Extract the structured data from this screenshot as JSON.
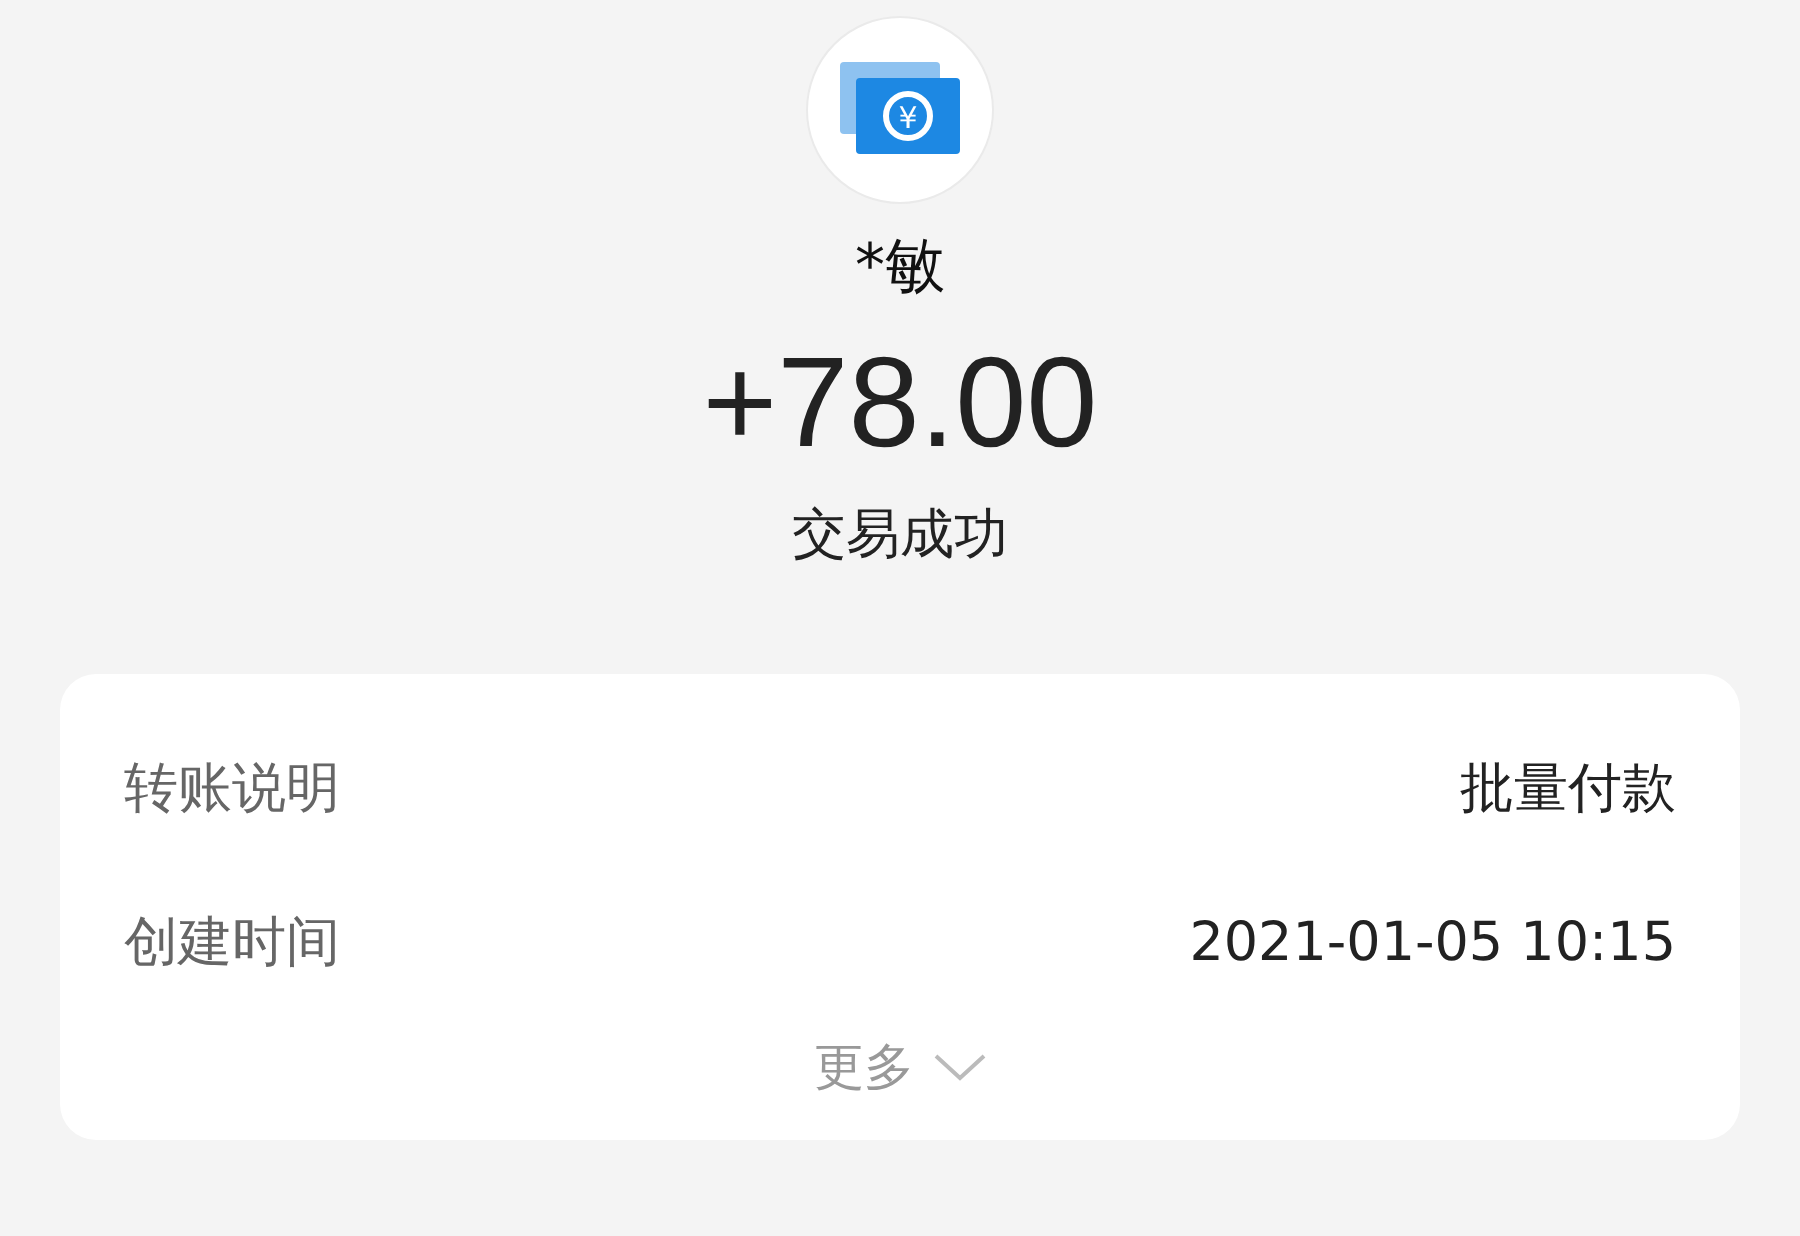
{
  "header": {
    "icon_symbol": "¥",
    "name": "*敏",
    "amount": "+78.00",
    "status": "交易成功"
  },
  "details": [
    {
      "label": "转账说明",
      "value": "批量付款"
    },
    {
      "label": "创建时间",
      "value": "2021-01-05 10:15"
    }
  ],
  "more_link": "更多"
}
